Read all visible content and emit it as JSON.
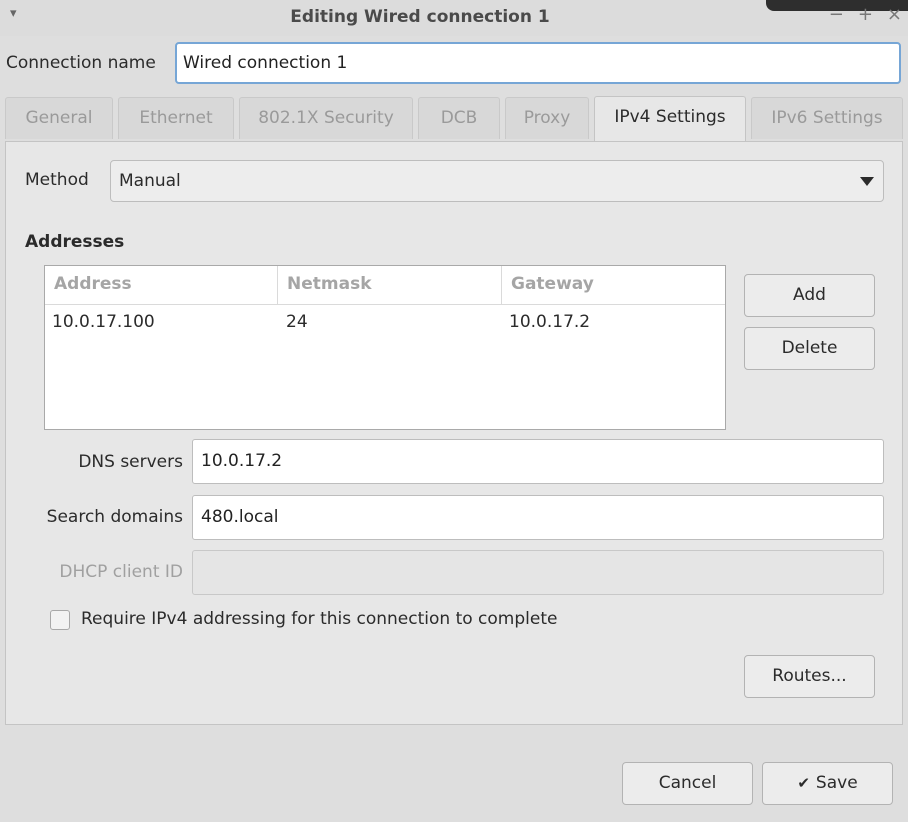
{
  "window": {
    "title": "Editing Wired connection 1",
    "menu_icon": "▾",
    "minimize": "−",
    "maximize": "+",
    "close": "×"
  },
  "connection": {
    "label": "Connection name",
    "value": "Wired connection 1"
  },
  "tabs": [
    {
      "label": "General",
      "active": false
    },
    {
      "label": "Ethernet",
      "active": false
    },
    {
      "label": "802.1X Security",
      "active": false
    },
    {
      "label": "DCB",
      "active": false
    },
    {
      "label": "Proxy",
      "active": false
    },
    {
      "label": "IPv4 Settings",
      "active": true
    },
    {
      "label": "IPv6 Settings",
      "active": false
    }
  ],
  "ipv4": {
    "method_label": "Method",
    "method_value": "Manual",
    "addresses_heading": "Addresses",
    "columns": [
      "Address",
      "Netmask",
      "Gateway"
    ],
    "rows": [
      [
        "10.0.17.100",
        "24",
        "10.0.17.2"
      ]
    ],
    "add_label": "Add",
    "delete_label": "Delete",
    "dns_label": "DNS servers",
    "dns_value": "10.0.17.2",
    "search_label": "Search domains",
    "search_value": "480.local",
    "dhcp_label": "DHCP client ID",
    "dhcp_value": "",
    "require_label": "Require IPv4 addressing for this connection to complete",
    "require_checked": false,
    "routes_label": "Routes..."
  },
  "footer": {
    "cancel_label": "Cancel",
    "save_label": "Save",
    "save_icon": "✔"
  },
  "colors": {
    "focus_border": "#76a6d6",
    "window_bg": "#dedede"
  }
}
